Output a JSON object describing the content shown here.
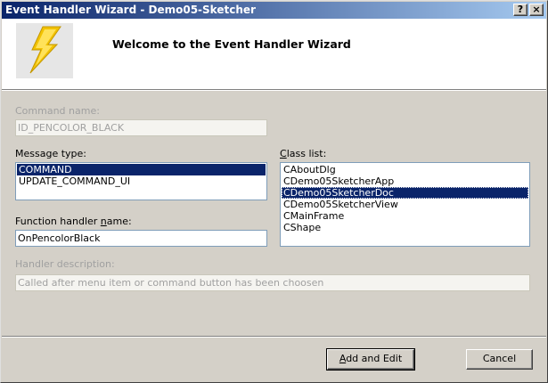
{
  "window": {
    "title": "Event Handler Wizard - Demo05-Sketcher",
    "help_button": "?",
    "close_button": "×"
  },
  "header": {
    "title": "Welcome to the Event Handler Wizard",
    "logo_icon": "lightning-bolt-icon"
  },
  "command_name": {
    "label": "Command name:",
    "value": "ID_PENCOLOR_BLACK"
  },
  "message_type": {
    "label": "Message type:",
    "items": [
      "COMMAND",
      "UPDATE_COMMAND_UI"
    ],
    "selected_index": 0
  },
  "class_list": {
    "label_prefix": "",
    "label_accel": "C",
    "label_rest": "lass list:",
    "items": [
      "CAboutDlg",
      "CDemo05SketcherApp",
      "CDemo05SketcherDoc",
      "CDemo05SketcherView",
      "CMainFrame",
      "CShape"
    ],
    "selected_index": 2
  },
  "function_handler": {
    "label_prefix": "Function handler ",
    "label_accel": "n",
    "label_rest": "ame:",
    "value": "OnPencolorBlack"
  },
  "handler_description": {
    "label": "Handler description:",
    "value": "Called after menu item or command button has been choosen"
  },
  "buttons": {
    "add_edit_prefix": "",
    "add_edit_accel": "A",
    "add_edit_rest": "dd and Edit",
    "cancel": "Cancel"
  },
  "colors": {
    "titlebar_start": "#0a246a",
    "titlebar_end": "#a6caf0",
    "selection": "#0a246a",
    "dialog_bg": "#d4d0c8",
    "bolt": "#f2c200"
  }
}
